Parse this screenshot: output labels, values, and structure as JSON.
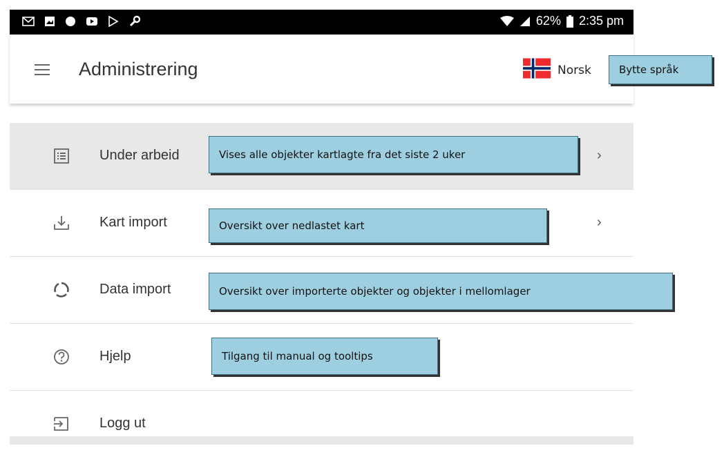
{
  "status_bar": {
    "battery": "62%",
    "time": "2:35 pm"
  },
  "app_bar": {
    "title": "Administrering",
    "language_label": "Norsk",
    "change_language_callout": "Bytte språk"
  },
  "menu": {
    "items": [
      {
        "label": "Under arbeid",
        "icon": "list-icon",
        "has_chevron": true,
        "callout": "Vises alle objekter kartlagte fra det siste 2 uker"
      },
      {
        "label": "Kart import",
        "icon": "download-icon",
        "has_chevron": true,
        "callout": "Oversikt over nedlastet kart"
      },
      {
        "label": "Data import",
        "icon": "sync-icon",
        "has_chevron": false,
        "callout": "Oversikt over importerte objekter og objekter i mellomlager"
      },
      {
        "label": "Hjelp",
        "icon": "help-icon",
        "has_chevron": false,
        "callout": "Tilgang til manual og tooltips"
      },
      {
        "label": "Logg ut",
        "icon": "logout-icon",
        "has_chevron": false
      }
    ],
    "chevron": "›"
  },
  "colors": {
    "callout_bg": "#9ecfe0",
    "status_bar": "#000000",
    "active_row": "#e8e8e8"
  }
}
